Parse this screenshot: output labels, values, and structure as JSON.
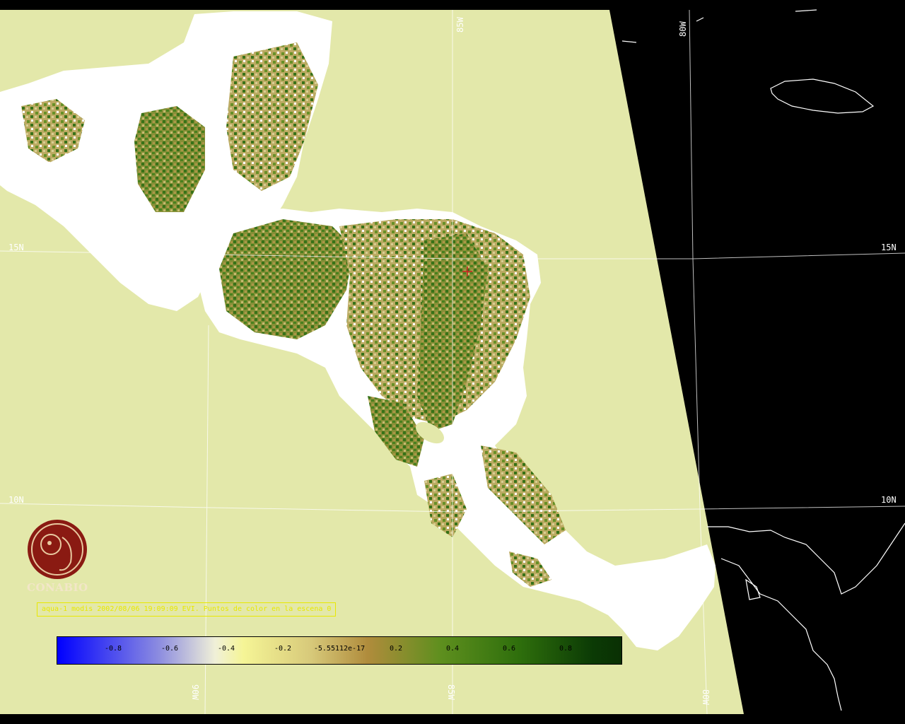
{
  "grid_labels": {
    "lat_15": "15N",
    "lat_10": "10N",
    "lon_85": "85W",
    "lon_80": "80W",
    "lon_90": "90W"
  },
  "logo": {
    "name": "CONABIO"
  },
  "caption": "aqua-1 modis 2002/08/06 19:09:09 EVI. Puntos de color en la escena 0",
  "colorbar": {
    "ticks": [
      "-0.8",
      "-0.6",
      "-0.4",
      "-0.2",
      "-5.55112e-17",
      "0.2",
      "0.4",
      "0.6",
      "0.8"
    ],
    "min": -1,
    "max": 1
  },
  "colors": {
    "ocean": "#e3e8aa",
    "space": "#000000",
    "land_masked": "#ffffff",
    "vegetation_dark": "#2d6b0c",
    "vegetation_light": "#a8913f",
    "marker": "#cc2222",
    "caption": "#e8e800"
  }
}
